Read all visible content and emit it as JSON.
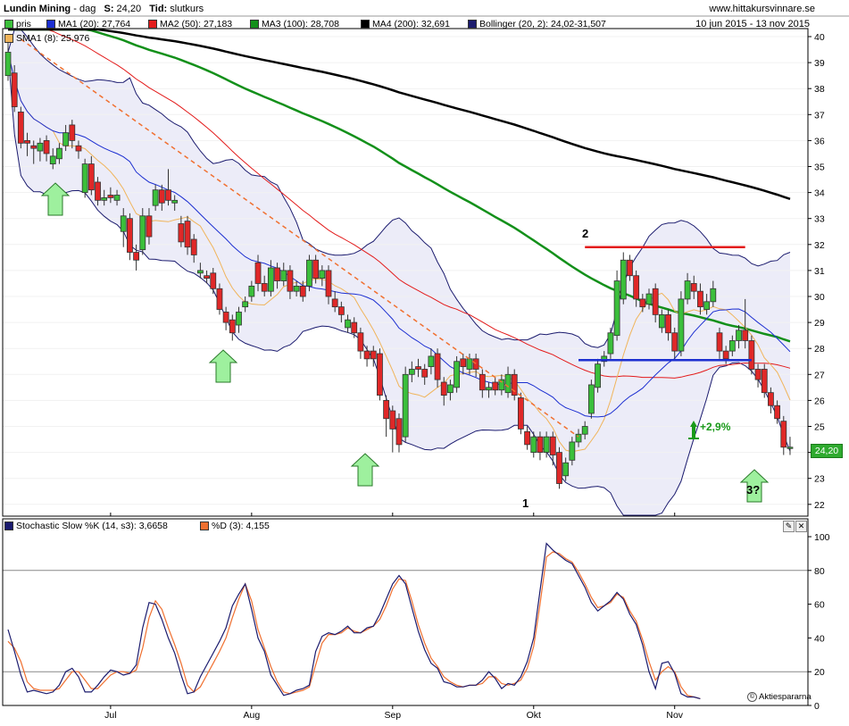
{
  "header": {
    "name": "Lundin Mining",
    "period": "dag",
    "last_label": "S:",
    "last_value": "24,20",
    "type_label": "Tid:",
    "type_value": "slutkurs",
    "site": "www.hittakursvinnare.se",
    "date_range": "10 jun 2015 - 13 nov 2015"
  },
  "legend": [
    {
      "label": "pris",
      "color": "#3bbf3b"
    },
    {
      "label": "MA1 (20): 27,764",
      "color": "#1c2fd1"
    },
    {
      "label": "MA2 (50): 27,183",
      "color": "#e31b1b"
    },
    {
      "label": "MA3 (100): 28,708",
      "color": "#13901a"
    },
    {
      "label": "MA4 (200): 32,691",
      "color": "#000000"
    },
    {
      "label": "Bollinger (20, 2): 24,02-31,507",
      "color": "#1b1b6e"
    },
    {
      "label": "SMA1 (8): 25,976",
      "color": "#f0b45a"
    }
  ],
  "price_tag": "24,20",
  "stoch_legend": [
    {
      "label": "Stochastic Slow %K (14, s3): 3,6658",
      "color": "#1b1b6e"
    },
    {
      "label": "%D (3): 4,155",
      "color": "#f07030"
    }
  ],
  "watermark": "Aktiespararna",
  "annotations": {
    "point1": "1",
    "point2": "2",
    "gain": "+2,9%",
    "question": "3?"
  },
  "chart_data": [
    {
      "type": "candlestick",
      "title": "Lundin Mining",
      "ylim": [
        21.8,
        40.2
      ],
      "y_ticks": [
        22,
        23,
        24,
        25,
        26,
        27,
        28,
        29,
        30,
        31,
        32,
        33,
        34,
        35,
        36,
        37,
        38,
        39,
        40
      ],
      "x_ticks": [
        {
          "label": "Jul",
          "i": 16
        },
        {
          "label": "Aug",
          "i": 38
        },
        {
          "label": "Sep",
          "i": 60
        },
        {
          "label": "Okt",
          "i": 82
        },
        {
          "label": "Nov",
          "i": 104
        }
      ],
      "resistance": 31.9,
      "support": 27.55,
      "candles": [
        {
          "o": 38.5,
          "c": 39.4,
          "h": 39.8,
          "l": 38.3
        },
        {
          "o": 38.6,
          "c": 37.3,
          "h": 38.9,
          "l": 37.1
        },
        {
          "o": 37.1,
          "c": 35.9,
          "h": 37.3,
          "l": 35.7
        },
        {
          "o": 36.0,
          "c": 35.9,
          "h": 36.3,
          "l": 35.4
        },
        {
          "o": 35.8,
          "c": 35.7,
          "h": 36.0,
          "l": 35.1
        },
        {
          "o": 35.6,
          "c": 35.9,
          "h": 36.1,
          "l": 35.2
        },
        {
          "o": 36.0,
          "c": 35.5,
          "h": 36.2,
          "l": 35.2
        },
        {
          "o": 35.1,
          "c": 35.4,
          "h": 35.7,
          "l": 34.9
        },
        {
          "o": 35.3,
          "c": 35.7,
          "h": 35.9,
          "l": 35.1
        },
        {
          "o": 35.8,
          "c": 36.3,
          "h": 36.6,
          "l": 35.6
        },
        {
          "o": 36.6,
          "c": 36.0,
          "h": 36.8,
          "l": 35.7
        },
        {
          "o": 35.8,
          "c": 35.6,
          "h": 36.0,
          "l": 35.3
        },
        {
          "o": 34.0,
          "c": 35.1,
          "h": 35.3,
          "l": 33.8
        },
        {
          "o": 35.1,
          "c": 34.1,
          "h": 35.4,
          "l": 33.9
        },
        {
          "o": 34.4,
          "c": 33.7,
          "h": 34.6,
          "l": 33.5
        },
        {
          "o": 33.7,
          "c": 33.8,
          "h": 34.1,
          "l": 33.5
        },
        {
          "o": 33.9,
          "c": 33.8,
          "h": 34.2,
          "l": 33.6
        },
        {
          "o": 33.7,
          "c": 33.9,
          "h": 34.1,
          "l": 33.5
        },
        {
          "o": 32.5,
          "c": 33.1,
          "h": 33.4,
          "l": 31.9
        },
        {
          "o": 33.0,
          "c": 31.7,
          "h": 33.2,
          "l": 31.4
        },
        {
          "o": 31.7,
          "c": 31.4,
          "h": 32.0,
          "l": 31.0
        },
        {
          "o": 31.8,
          "c": 33.1,
          "h": 33.4,
          "l": 31.6
        },
        {
          "o": 33.1,
          "c": 32.3,
          "h": 33.4,
          "l": 32.0
        },
        {
          "o": 33.5,
          "c": 34.1,
          "h": 34.3,
          "l": 33.3
        },
        {
          "o": 34.1,
          "c": 33.6,
          "h": 34.3,
          "l": 33.3
        },
        {
          "o": 34.1,
          "c": 33.7,
          "h": 34.9,
          "l": 33.5
        },
        {
          "o": 33.6,
          "c": 33.7,
          "h": 33.9,
          "l": 33.3
        },
        {
          "o": 32.8,
          "c": 32.1,
          "h": 33.1,
          "l": 31.9
        },
        {
          "o": 32.9,
          "c": 31.9,
          "h": 33.1,
          "l": 31.6
        },
        {
          "o": 32.2,
          "c": 31.6,
          "h": 32.4,
          "l": 31.3
        },
        {
          "o": 30.9,
          "c": 31.0,
          "h": 31.3,
          "l": 30.7
        },
        {
          "o": 30.8,
          "c": 30.7,
          "h": 31.0,
          "l": 30.5
        },
        {
          "o": 30.9,
          "c": 30.3,
          "h": 31.1,
          "l": 30.1
        },
        {
          "o": 30.3,
          "c": 29.5,
          "h": 30.5,
          "l": 29.3
        },
        {
          "o": 29.4,
          "c": 29.0,
          "h": 29.6,
          "l": 28.7
        },
        {
          "o": 29.1,
          "c": 28.6,
          "h": 29.3,
          "l": 28.3
        },
        {
          "o": 28.9,
          "c": 29.4,
          "h": 29.6,
          "l": 28.6
        },
        {
          "o": 29.6,
          "c": 29.8,
          "h": 30.0,
          "l": 29.4
        },
        {
          "o": 30.0,
          "c": 30.4,
          "h": 30.6,
          "l": 29.8
        },
        {
          "o": 31.3,
          "c": 30.5,
          "h": 31.6,
          "l": 30.2
        },
        {
          "o": 30.5,
          "c": 30.2,
          "h": 30.8,
          "l": 30.0
        },
        {
          "o": 30.2,
          "c": 31.1,
          "h": 31.4,
          "l": 30.0
        },
        {
          "o": 31.1,
          "c": 30.6,
          "h": 31.3,
          "l": 30.3
        },
        {
          "o": 30.6,
          "c": 31.0,
          "h": 31.3,
          "l": 30.4
        },
        {
          "o": 31.0,
          "c": 30.2,
          "h": 31.2,
          "l": 29.9
        },
        {
          "o": 30.2,
          "c": 30.4,
          "h": 30.6,
          "l": 30.0
        },
        {
          "o": 30.4,
          "c": 30.0,
          "h": 30.6,
          "l": 29.8
        },
        {
          "o": 30.4,
          "c": 31.4,
          "h": 31.6,
          "l": 30.2
        },
        {
          "o": 31.4,
          "c": 30.7,
          "h": 31.6,
          "l": 30.5
        },
        {
          "o": 30.7,
          "c": 31.0,
          "h": 31.2,
          "l": 30.4
        },
        {
          "o": 31.0,
          "c": 30.0,
          "h": 31.2,
          "l": 29.7
        },
        {
          "o": 29.9,
          "c": 29.6,
          "h": 30.2,
          "l": 29.4
        },
        {
          "o": 29.6,
          "c": 29.3,
          "h": 29.8,
          "l": 29.0
        },
        {
          "o": 28.8,
          "c": 29.1,
          "h": 29.3,
          "l": 28.6
        },
        {
          "o": 29.0,
          "c": 28.6,
          "h": 29.2,
          "l": 28.4
        },
        {
          "o": 28.6,
          "c": 27.9,
          "h": 28.8,
          "l": 27.6
        },
        {
          "o": 27.9,
          "c": 27.6,
          "h": 28.1,
          "l": 27.3
        },
        {
          "o": 27.9,
          "c": 27.6,
          "h": 28.1,
          "l": 27.3
        },
        {
          "o": 27.8,
          "c": 26.2,
          "h": 28.0,
          "l": 26.0
        },
        {
          "o": 26.0,
          "c": 25.3,
          "h": 26.2,
          "l": 24.6
        },
        {
          "o": 25.6,
          "c": 24.9,
          "h": 25.8,
          "l": 24.0
        },
        {
          "o": 25.3,
          "c": 24.3,
          "h": 25.5,
          "l": 24.0
        },
        {
          "o": 24.6,
          "c": 27.0,
          "h": 27.3,
          "l": 24.4
        },
        {
          "o": 27.0,
          "c": 27.2,
          "h": 27.5,
          "l": 26.7
        },
        {
          "o": 27.3,
          "c": 27.2,
          "h": 27.6,
          "l": 26.9
        },
        {
          "o": 27.2,
          "c": 26.9,
          "h": 27.4,
          "l": 26.6
        },
        {
          "o": 27.3,
          "c": 27.7,
          "h": 28.0,
          "l": 27.0
        },
        {
          "o": 27.8,
          "c": 26.8,
          "h": 28.0,
          "l": 26.5
        },
        {
          "o": 26.7,
          "c": 26.2,
          "h": 26.9,
          "l": 25.8
        },
        {
          "o": 26.3,
          "c": 26.6,
          "h": 26.8,
          "l": 26.0
        },
        {
          "o": 26.5,
          "c": 27.5,
          "h": 27.7,
          "l": 26.3
        },
        {
          "o": 27.6,
          "c": 27.3,
          "h": 27.8,
          "l": 27.0
        },
        {
          "o": 27.2,
          "c": 27.6,
          "h": 27.8,
          "l": 27.0
        },
        {
          "o": 27.6,
          "c": 27.2,
          "h": 27.8,
          "l": 26.9
        },
        {
          "o": 27.0,
          "c": 26.4,
          "h": 27.2,
          "l": 26.1
        },
        {
          "o": 26.4,
          "c": 26.5,
          "h": 26.7,
          "l": 26.1
        },
        {
          "o": 26.7,
          "c": 26.4,
          "h": 26.9,
          "l": 26.2
        },
        {
          "o": 26.4,
          "c": 26.8,
          "h": 27.0,
          "l": 26.2
        },
        {
          "o": 26.3,
          "c": 27.0,
          "h": 27.3,
          "l": 26.1
        },
        {
          "o": 27.0,
          "c": 26.2,
          "h": 27.2,
          "l": 26.0
        },
        {
          "o": 26.1,
          "c": 24.9,
          "h": 26.3,
          "l": 24.7
        },
        {
          "o": 24.8,
          "c": 24.3,
          "h": 25.0,
          "l": 24.1
        },
        {
          "o": 24.0,
          "c": 24.6,
          "h": 24.8,
          "l": 23.8
        },
        {
          "o": 24.6,
          "c": 24.0,
          "h": 24.8,
          "l": 23.7
        },
        {
          "o": 24.0,
          "c": 24.6,
          "h": 24.8,
          "l": 23.8
        },
        {
          "o": 24.6,
          "c": 23.9,
          "h": 24.8,
          "l": 23.5
        },
        {
          "o": 24.0,
          "c": 22.8,
          "h": 24.2,
          "l": 22.6
        },
        {
          "o": 23.1,
          "c": 23.6,
          "h": 23.8,
          "l": 22.9
        },
        {
          "o": 23.7,
          "c": 24.4,
          "h": 24.6,
          "l": 23.5
        },
        {
          "o": 24.4,
          "c": 24.7,
          "h": 24.9,
          "l": 24.2
        },
        {
          "o": 24.7,
          "c": 25.0,
          "h": 25.2,
          "l": 24.5
        },
        {
          "o": 25.5,
          "c": 26.6,
          "h": 26.8,
          "l": 25.3
        },
        {
          "o": 26.5,
          "c": 27.4,
          "h": 27.6,
          "l": 26.3
        },
        {
          "o": 27.5,
          "c": 27.7,
          "h": 27.9,
          "l": 27.3
        },
        {
          "o": 27.8,
          "c": 28.6,
          "h": 28.8,
          "l": 27.6
        },
        {
          "o": 28.5,
          "c": 30.6,
          "h": 31.0,
          "l": 28.3
        },
        {
          "o": 29.9,
          "c": 31.4,
          "h": 31.7,
          "l": 29.7
        },
        {
          "o": 31.4,
          "c": 30.8,
          "h": 31.6,
          "l": 30.6
        },
        {
          "o": 30.8,
          "c": 29.9,
          "h": 31.0,
          "l": 29.6
        },
        {
          "o": 29.9,
          "c": 29.6,
          "h": 30.1,
          "l": 29.4
        },
        {
          "o": 29.7,
          "c": 30.1,
          "h": 30.3,
          "l": 29.5
        },
        {
          "o": 30.3,
          "c": 29.3,
          "h": 30.5,
          "l": 29.0
        },
        {
          "o": 28.8,
          "c": 29.3,
          "h": 29.5,
          "l": 28.6
        },
        {
          "o": 29.3,
          "c": 28.6,
          "h": 29.5,
          "l": 28.3
        },
        {
          "o": 28.6,
          "c": 27.9,
          "h": 28.8,
          "l": 27.6
        },
        {
          "o": 27.9,
          "c": 29.9,
          "h": 30.2,
          "l": 27.7
        },
        {
          "o": 29.9,
          "c": 30.6,
          "h": 30.9,
          "l": 29.7
        },
        {
          "o": 30.5,
          "c": 30.2,
          "h": 30.8,
          "l": 29.9
        },
        {
          "o": 30.2,
          "c": 29.6,
          "h": 30.5,
          "l": 29.3
        },
        {
          "o": 29.5,
          "c": 29.8,
          "h": 30.1,
          "l": 29.3
        },
        {
          "o": 29.8,
          "c": 30.3,
          "h": 30.6,
          "l": 29.6
        },
        {
          "o": 28.6,
          "c": 27.9,
          "h": 28.8,
          "l": 27.6
        },
        {
          "o": 27.9,
          "c": 27.6,
          "h": 28.1,
          "l": 27.4
        },
        {
          "o": 27.9,
          "c": 28.3,
          "h": 28.5,
          "l": 27.7
        },
        {
          "o": 28.3,
          "c": 28.7,
          "h": 28.9,
          "l": 28.0
        },
        {
          "o": 28.7,
          "c": 28.3,
          "h": 29.9,
          "l": 28.0
        },
        {
          "o": 28.3,
          "c": 27.2,
          "h": 28.5,
          "l": 27.0
        },
        {
          "o": 27.2,
          "c": 26.8,
          "h": 27.4,
          "l": 26.5
        },
        {
          "o": 27.2,
          "c": 26.3,
          "h": 27.4,
          "l": 26.1
        },
        {
          "o": 26.3,
          "c": 25.8,
          "h": 26.5,
          "l": 25.5
        },
        {
          "o": 25.8,
          "c": 25.3,
          "h": 26.0,
          "l": 25.1
        },
        {
          "o": 25.2,
          "c": 24.2,
          "h": 25.4,
          "l": 23.9
        },
        {
          "o": 24.2,
          "c": 24.2,
          "h": 24.6,
          "l": 23.9
        }
      ]
    },
    {
      "type": "line",
      "title": "Stochastic Slow",
      "ylim": [
        0,
        100
      ],
      "y_ticks": [
        0,
        20,
        40,
        60,
        80,
        100
      ],
      "reference_lines": [
        20,
        80
      ],
      "series": [
        {
          "name": "Stochastic Slow %K (14, s3)",
          "color": "#1b1b6e",
          "values": [
            45,
            32,
            18,
            8,
            9,
            8,
            7,
            8,
            12,
            20,
            22,
            17,
            8,
            8,
            12,
            17,
            21,
            20,
            18,
            19,
            24,
            46,
            61,
            60,
            51,
            40,
            31,
            18,
            7,
            8,
            17,
            24,
            31,
            38,
            46,
            59,
            66,
            72,
            57,
            40,
            32,
            18,
            12,
            6,
            7,
            9,
            10,
            12,
            32,
            41,
            43,
            42,
            44,
            47,
            43,
            43,
            46,
            47,
            54,
            63,
            72,
            77,
            72,
            58,
            44,
            33,
            25,
            22,
            14,
            13,
            11,
            11,
            12,
            12,
            15,
            20,
            16,
            10,
            13,
            12,
            17,
            26,
            40,
            68,
            96,
            92,
            89,
            86,
            84,
            77,
            70,
            61,
            56,
            59,
            62,
            67,
            63,
            54,
            48,
            36,
            20,
            10,
            25,
            26,
            19,
            7,
            5,
            5,
            4
          ]
        },
        {
          "name": "%D (3)",
          "color": "#f07030",
          "values": [
            38,
            34,
            26,
            14,
            10,
            9,
            9,
            9,
            10,
            15,
            20,
            20,
            15,
            10,
            10,
            14,
            18,
            20,
            20,
            19,
            21,
            34,
            52,
            62,
            57,
            46,
            36,
            25,
            12,
            8,
            11,
            18,
            25,
            32,
            40,
            52,
            63,
            72,
            62,
            45,
            34,
            23,
            14,
            8,
            7,
            8,
            9,
            11,
            24,
            37,
            42,
            42,
            43,
            46,
            44,
            43,
            45,
            47,
            51,
            59,
            69,
            75,
            74,
            62,
            48,
            37,
            28,
            23,
            17,
            14,
            12,
            11,
            12,
            12,
            13,
            17,
            17,
            13,
            12,
            13,
            15,
            22,
            35,
            60,
            88,
            91,
            90,
            87,
            85,
            79,
            72,
            64,
            58,
            59,
            61,
            66,
            64,
            56,
            50,
            39,
            26,
            15,
            20,
            23,
            20,
            11,
            6,
            5,
            4
          ]
        }
      ]
    }
  ]
}
